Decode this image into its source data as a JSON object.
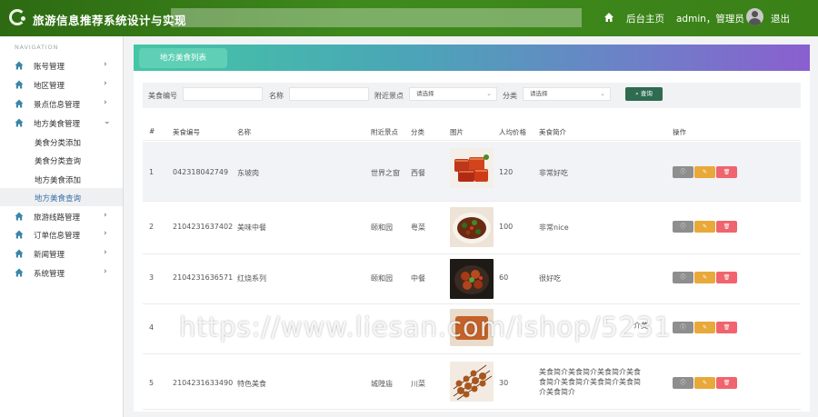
{
  "header": {
    "title": "旅游信息推荐系统设计与实现",
    "home_label": "后台主页",
    "user_label": "admin，管理员",
    "logout_label": "退出"
  },
  "sidebar": {
    "heading": "NAVIGATION",
    "items": [
      {
        "label": "账号管理"
      },
      {
        "label": "地区管理"
      },
      {
        "label": "景点信息管理"
      },
      {
        "label": "地方美食管理"
      },
      {
        "label": "旅游线路管理"
      },
      {
        "label": "订单信息管理"
      },
      {
        "label": "新闻管理"
      },
      {
        "label": "系统管理"
      }
    ],
    "sub_items": [
      {
        "label": "美食分类添加"
      },
      {
        "label": "美食分类查询"
      },
      {
        "label": "地方美食添加"
      },
      {
        "label": "地方美食查询"
      }
    ]
  },
  "tab": {
    "label": "地方美食列表"
  },
  "search": {
    "code_label": "美食编号",
    "name_label": "名称",
    "spot_label": "附近景点",
    "spot_placeholder": "请选择",
    "category_label": "分类",
    "category_placeholder": "请选择",
    "query_label": "查询"
  },
  "table": {
    "headers": {
      "index": "#",
      "code": "美食编号",
      "name": "名称",
      "spot": "附近景点",
      "category": "分类",
      "image": "图片",
      "price": "人均价格",
      "intro": "美食简介",
      "ops": "操作"
    },
    "rows": [
      {
        "index": "1",
        "code": "042318042749",
        "name": "东坡肉",
        "spot": "世界之窗",
        "category": "西餐",
        "price": "120",
        "intro": "非常好吃",
        "intro2": ""
      },
      {
        "index": "2",
        "code": "2104231637402",
        "name": "美味中餐",
        "spot": "颐和园",
        "category": "粤菜",
        "price": "100",
        "intro": "非常nice",
        "intro2": ""
      },
      {
        "index": "3",
        "code": "2104231636571",
        "name": "红烧系列",
        "spot": "颐和园",
        "category": "中餐",
        "price": "60",
        "intro": "很好吃",
        "intro2": ""
      },
      {
        "index": "4",
        "code": "",
        "name": "",
        "spot": "",
        "category": "",
        "price": "",
        "intro": "介美",
        "intro2": ""
      },
      {
        "index": "5",
        "code": "2104231633490",
        "name": "特色美食",
        "spot": "城隍庙",
        "category": "川菜",
        "price": "30",
        "intro": "美食简介美食简介美食简介美食",
        "intro2": "食简介美食简介美食简介美食简",
        "intro3": "介美食简介"
      }
    ],
    "op_labels": {
      "view": "ⓘ",
      "edit": "✎",
      "delete": "🗑"
    }
  },
  "watermark": "https://www.liesan.com/ishop/5231",
  "colors": {
    "topbar": "#3a8118",
    "query_button": "#2e6b51",
    "edit": "#e8a93a",
    "delete": "#f0646e",
    "view": "#8e8e8e"
  }
}
